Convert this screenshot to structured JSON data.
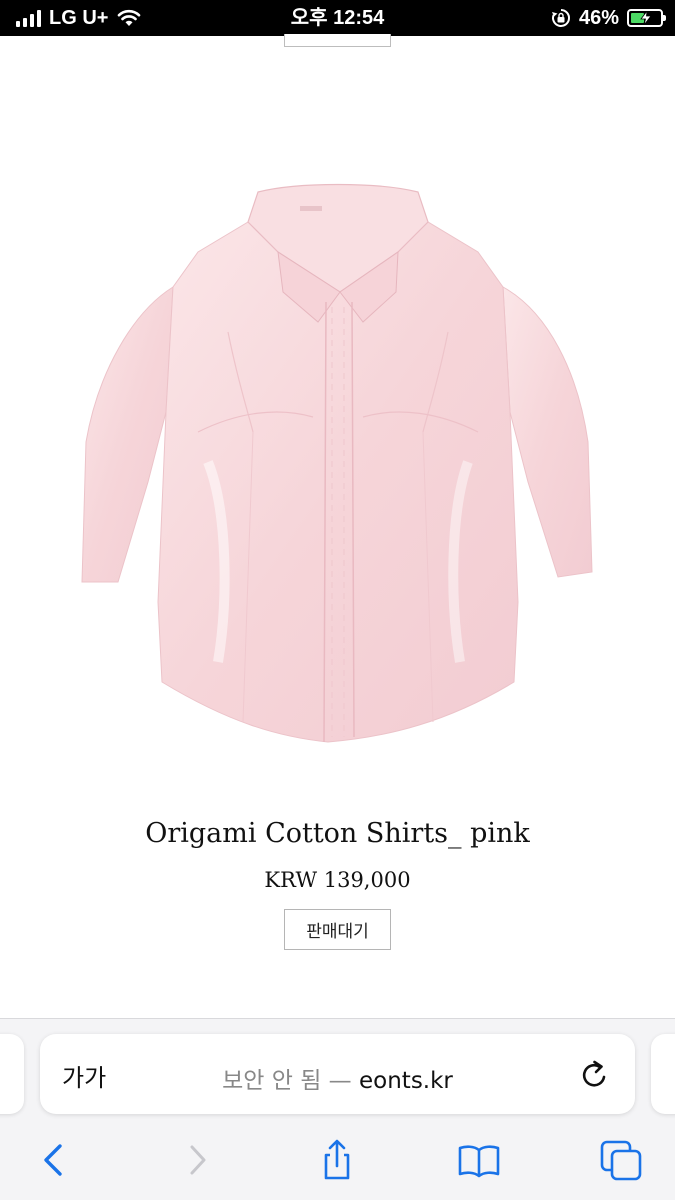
{
  "status_bar": {
    "carrier": "LG U+",
    "time": "오후 12:54",
    "battery_percent": "46%",
    "battery_level": 0.46,
    "icons": [
      "signal-icon",
      "wifi-icon",
      "rotation-lock-icon",
      "battery-charging-icon"
    ]
  },
  "product": {
    "name": "Origami Cotton Shirts_ pink",
    "price": "KRW 139,000",
    "status_label": "판매대기",
    "image": "pink-shirt-image"
  },
  "browser": {
    "text_size_label": "가가",
    "address_prefix": "보안 안 됨 — ",
    "address_domain": "eonts.kr",
    "icons": [
      "reload-icon",
      "back-icon",
      "forward-icon",
      "share-icon",
      "bookmarks-icon",
      "tabs-icon"
    ]
  },
  "colors": {
    "accent": "#1a73e8",
    "disabled": "#c7c7cc",
    "shirt": "#f7d8dc"
  }
}
